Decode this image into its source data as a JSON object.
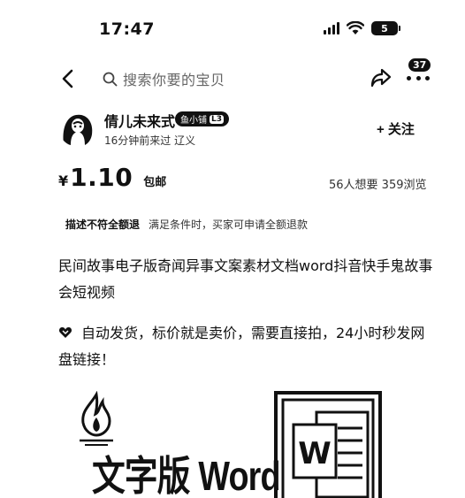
{
  "status": {
    "time": "17:47",
    "battery": "5"
  },
  "nav": {
    "search_text": "搜索你要的宝贝",
    "badge_count": "37"
  },
  "seller": {
    "name": "倩儿未来式",
    "level_label": "鱼小铺",
    "level": "L3",
    "meta": "16分钟前来过  辽义"
  },
  "follow_label": "+ 关注",
  "price": {
    "currency": "¥",
    "amount": "1.10",
    "shipping": "包邮"
  },
  "stats": "56人想要  359浏览",
  "protection": {
    "tag": "描述不符全额退",
    "desc": "满足条件时，买家可申请全额退款"
  },
  "title": "民间故事电子版奇闻异事文案素材文档word抖音快手鬼故事会短视频",
  "description": "自动发货，标价就是卖价，需要直接拍，24小时秒发网盘链接！",
  "image": {
    "caption": "文字版 Word",
    "word_letter": "W"
  }
}
